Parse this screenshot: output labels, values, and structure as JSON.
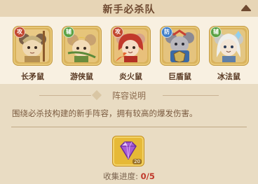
{
  "panel": {
    "title": "新手必杀队",
    "collapse_icon": "chevron-up-icon"
  },
  "heroes": [
    {
      "name": "长矛鼠",
      "badge": "攻",
      "badge_color": "#c2462f",
      "card_color": "#d9b25c"
    },
    {
      "name": "游侠鼠",
      "badge": "辅",
      "badge_color": "#5aa244",
      "card_color": "#d9b25c"
    },
    {
      "name": "炎火鼠",
      "badge": "攻",
      "badge_color": "#c2462f",
      "card_color": "#d9b25c"
    },
    {
      "name": "巨盾鼠",
      "badge": "防",
      "badge_color": "#3f7ec8",
      "card_color": "#d9b25c"
    },
    {
      "name": "冰法鼠",
      "badge": "辅",
      "badge_color": "#5aa244",
      "card_color": "#d9b25c"
    }
  ],
  "lineup": {
    "section_title": "阵容说明",
    "description": "围绕必杀技构建的新手阵容，拥有较高的爆发伤害。"
  },
  "reward": {
    "icon": "purple-gem-icon",
    "count": "20"
  },
  "collection": {
    "label": "收集进度:",
    "value": "0/5",
    "value_color": "#c0392b"
  }
}
